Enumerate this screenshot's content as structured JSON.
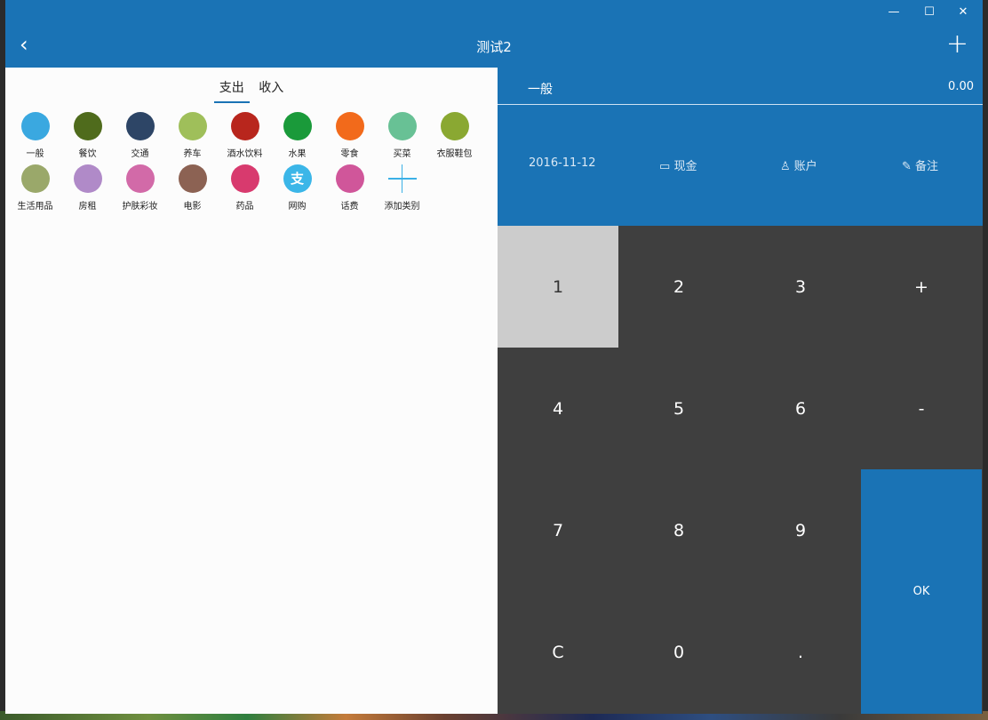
{
  "window": {
    "controls": {
      "minimize": "—",
      "maximize": "☐",
      "close": "✕"
    }
  },
  "header": {
    "back_icon": "‹",
    "title": "测试2",
    "add_icon": "+"
  },
  "tabs": [
    {
      "label": "支出",
      "active": true
    },
    {
      "label": "收入",
      "active": false
    }
  ],
  "categories": [
    {
      "label": "一般",
      "icon": "pie-chart-icon",
      "color": "#3aa8e0"
    },
    {
      "label": "餐饮",
      "icon": "skewer-icon",
      "color": "#4f6b1c"
    },
    {
      "label": "交通",
      "icon": "airplane-icon",
      "color": "#2d4566"
    },
    {
      "label": "养车",
      "icon": "car-icon",
      "color": "#9fbf5a"
    },
    {
      "label": "酒水饮料",
      "icon": "wine-icon",
      "color": "#b8261d"
    },
    {
      "label": "水果",
      "icon": "fruit-icon",
      "color": "#1a9a3a"
    },
    {
      "label": "零食",
      "icon": "snack-icon",
      "color": "#f26a1b"
    },
    {
      "label": "买菜",
      "icon": "cabbage-icon",
      "color": "#68c195"
    },
    {
      "label": "衣服鞋包",
      "icon": "bag-icon",
      "color": "#8aa832"
    },
    {
      "label": "生活用品",
      "icon": "shower-icon",
      "color": "#9aa86a"
    },
    {
      "label": "房租",
      "icon": "house-icon",
      "color": "#b08ac8"
    },
    {
      "label": "护肤彩妆",
      "icon": "lipstick-icon",
      "color": "#d26aa8"
    },
    {
      "label": "电影",
      "icon": "film-reel-icon",
      "color": "#8c6253"
    },
    {
      "label": "药品",
      "icon": "pill-icon",
      "color": "#d83a6e"
    },
    {
      "label": "网购",
      "icon": "alipay-icon",
      "color": "#3bb6e8",
      "glyph": "支"
    },
    {
      "label": "话费",
      "icon": "operator-icon",
      "color": "#d0569a"
    }
  ],
  "add_category": {
    "label": "添加类别",
    "icon": "plus-icon"
  },
  "entry": {
    "category": "一般",
    "amount": "0.00"
  },
  "meta": {
    "date": "2016-11-12",
    "cash_icon": "▭",
    "cash": "现金",
    "account_icon": "♙",
    "account": "账户",
    "note_icon": "✎",
    "note": "备注"
  },
  "keys": [
    "1",
    "2",
    "3",
    "+",
    "4",
    "5",
    "6",
    "-",
    "7",
    "8",
    "9",
    "C",
    "0",
    "."
  ],
  "ok_label": "OK",
  "colors": {
    "accent": "#1a73b5",
    "keypad": "#3f3f3f",
    "selected_key": "#cccccc"
  }
}
